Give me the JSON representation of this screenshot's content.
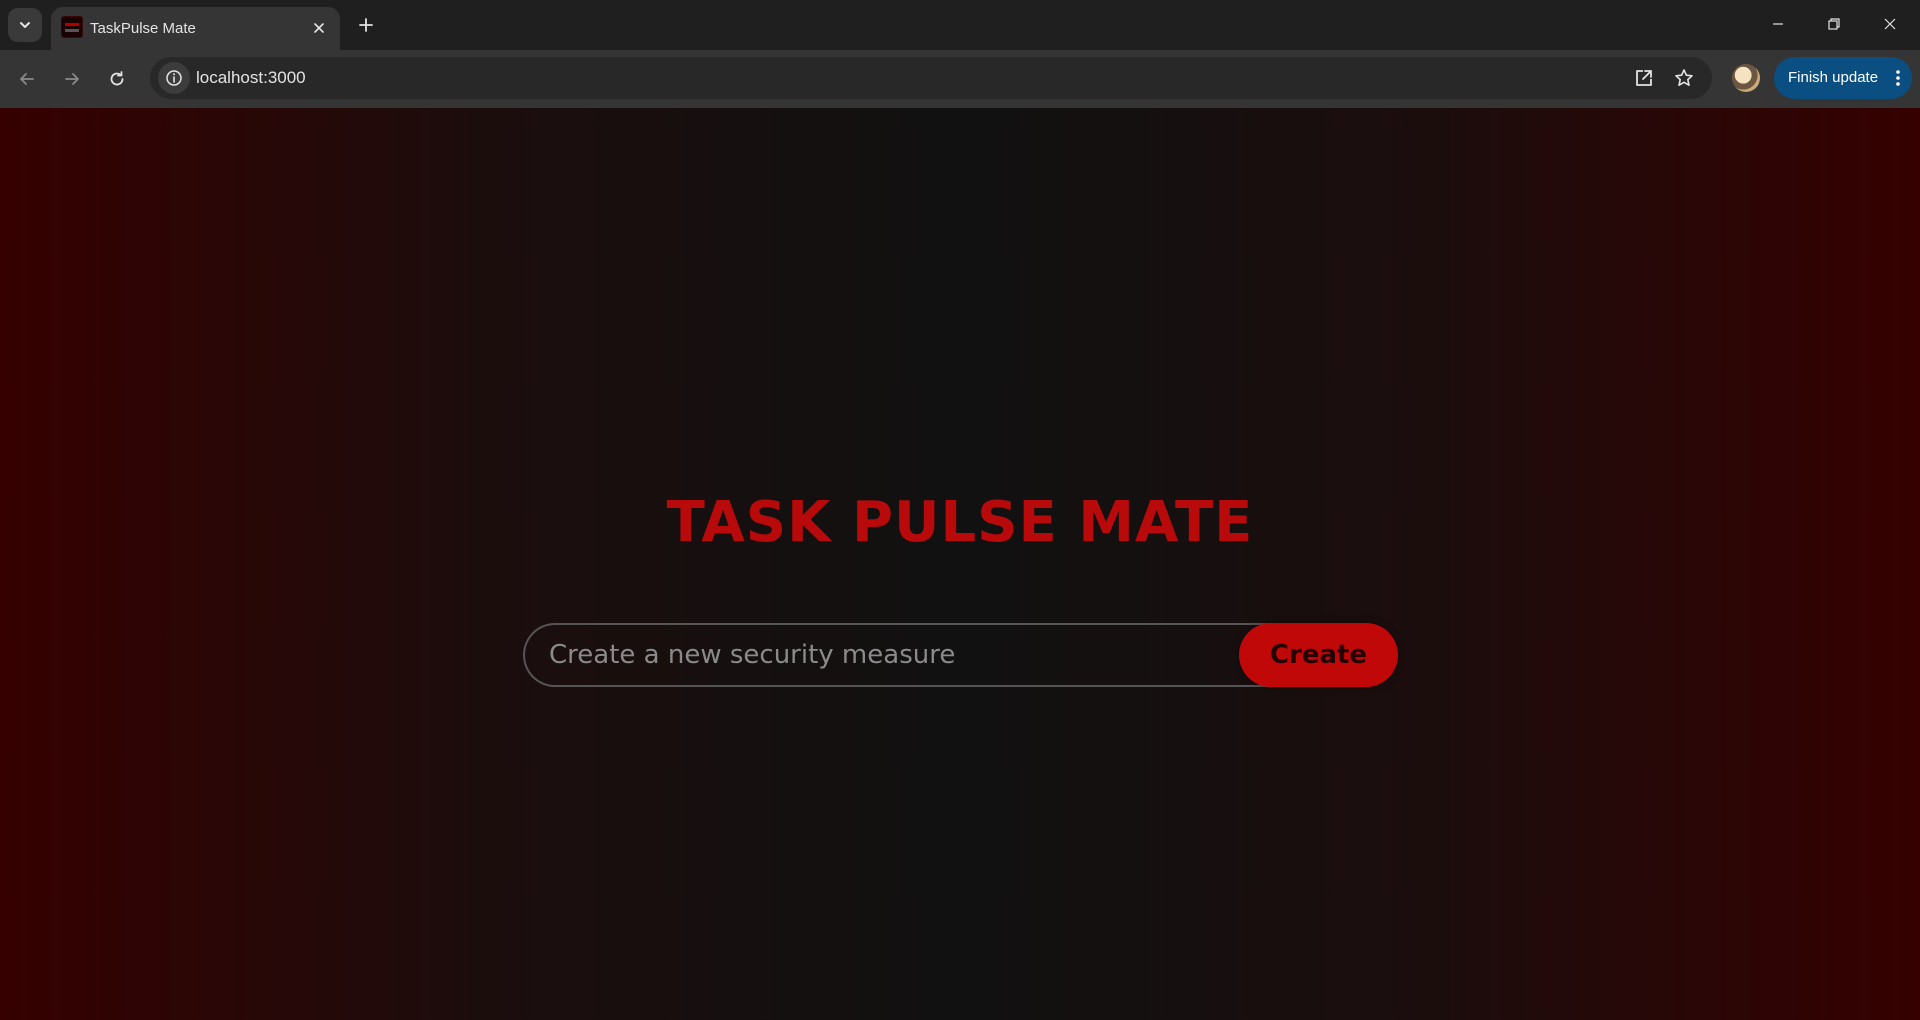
{
  "browser": {
    "tab": {
      "title": "TaskPulse Mate"
    },
    "address_bar": {
      "url": "localhost:3000"
    },
    "update_button": {
      "label": "Finish update"
    }
  },
  "icons": {
    "tab_search": "chevron-down-icon",
    "tab_close": "close-icon",
    "new_tab": "plus-icon",
    "back": "arrow-left-icon",
    "forward": "arrow-right-icon",
    "reload": "reload-icon",
    "site_info": "info-icon",
    "open_in_app": "open-external-icon",
    "bookmark": "star-icon",
    "menu": "kebab-menu-icon"
  },
  "page": {
    "title": "TASK PULSE MATE",
    "task_input": {
      "value": "",
      "placeholder": "Create a new security measure"
    },
    "create_button": {
      "label": "Create"
    }
  },
  "colors": {
    "accent": "#c10808",
    "title": "#b80a0a",
    "background_edge": "#360000",
    "background_center": "#111111",
    "update_button": "#0b4f82"
  }
}
